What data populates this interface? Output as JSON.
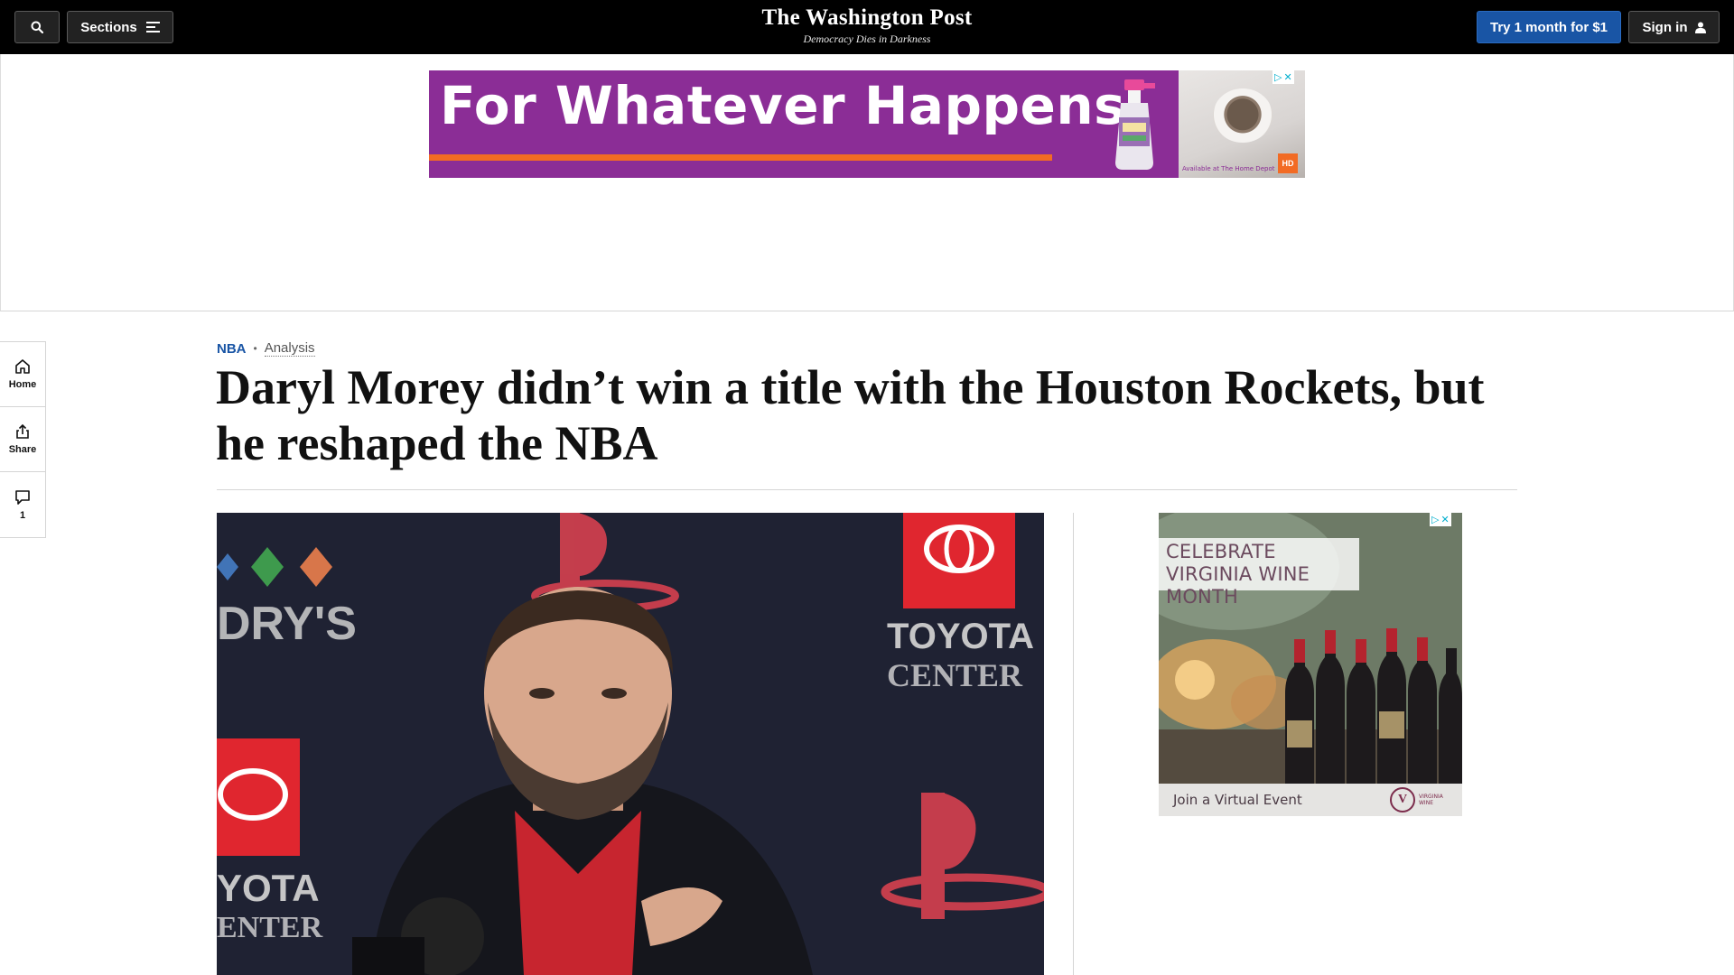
{
  "nav": {
    "sections_label": "Sections",
    "masthead_title": "The Washington Post",
    "masthead_tagline": "Democracy Dies in Darkness",
    "trial_label": "Try 1 month for $1",
    "signin_label": "Sign in",
    "icons": [
      "search-icon",
      "menu-icon",
      "user-icon"
    ]
  },
  "top_ad": {
    "headline": "For Whatever Happens",
    "fineprint": "Available at The Home Depot",
    "colors": {
      "background": "#8b2d96",
      "stripe": "#f26b24"
    }
  },
  "left_rail": {
    "items": [
      {
        "label": "Home",
        "icon": "home-icon"
      },
      {
        "label": "Share",
        "icon": "share-icon"
      },
      {
        "label": "1",
        "icon": "comment-icon"
      }
    ]
  },
  "article": {
    "section": "NBA",
    "label": "Analysis",
    "headline": "Daryl Morey didn’t win a title with the Houston Rockets, but he reshaped the NBA",
    "accent_color": "#1955a5"
  },
  "right_ad": {
    "title": "CELEBRATE VIRGINIA WINE MONTH",
    "cta": "Join a Virtual Event",
    "brand": "VIRGINIA WINE"
  }
}
